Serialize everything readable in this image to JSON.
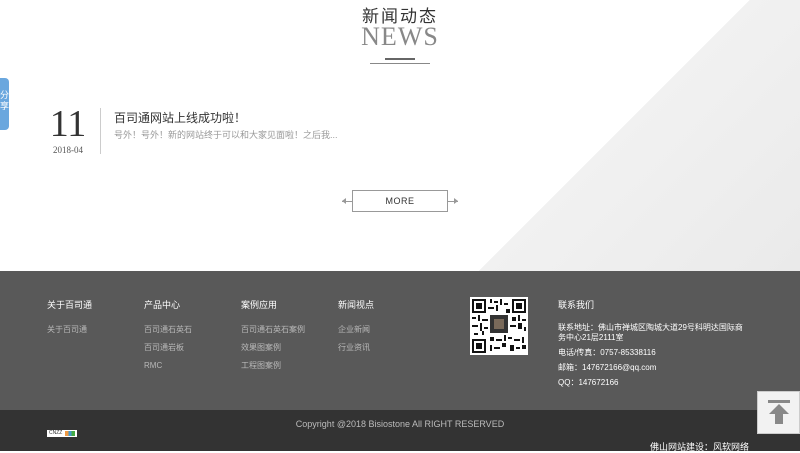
{
  "section": {
    "title": "新闻动态",
    "subtitle": "NEWS"
  },
  "share": {
    "label": "分享"
  },
  "news": {
    "day": "11",
    "date": "2018-04",
    "title": "百司通网站上线成功啦！",
    "excerpt": "号外！号外！新的网站终于可以和大家见面啦！之后我..."
  },
  "more_label": "MORE",
  "footer": {
    "columns": [
      {
        "head": "关于百司通",
        "links": [
          "关于百司通"
        ]
      },
      {
        "head": "产品中心",
        "links": [
          "百司通石英石",
          "百司通岩板",
          "RMC"
        ]
      },
      {
        "head": "案例应用",
        "links": [
          "百司通石英石案例",
          "效果图案例",
          "工程图案例"
        ]
      },
      {
        "head": "新闻视点",
        "links": [
          "企业新闻",
          "行业资讯"
        ]
      }
    ],
    "contact": {
      "head": "联系我们",
      "address": "联系地址：佛山市禅城区陶城大道29号科明达国际商务中心21层2111室",
      "phone": "电话/传真：0757-85338116",
      "email": "邮箱：147672166@qq.com",
      "qq": "QQ：147672166"
    }
  },
  "bottom": {
    "copyright": "Copyright @2018 Bisiostone All RIGHT RESERVED",
    "builder": "佛山网站建设：风软网络",
    "cnzz": "CNZZ"
  },
  "icons": {
    "back_to_top": "arrow-up-icon",
    "qr": "qr-code-icon"
  }
}
